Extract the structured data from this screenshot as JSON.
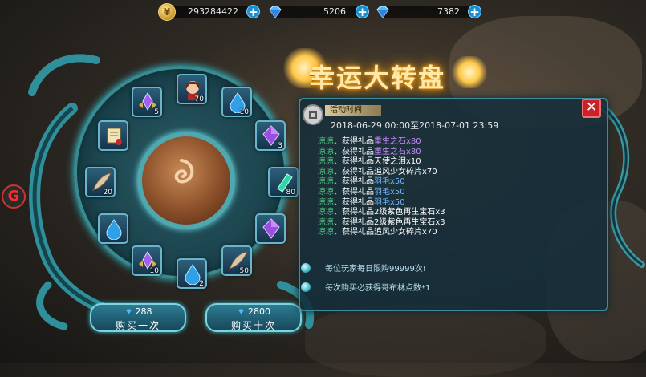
{
  "currencies": [
    {
      "icon": "gold-coin-icon",
      "value": "293284422"
    },
    {
      "icon": "diamond-icon",
      "value": "5206"
    },
    {
      "icon": "diamond-icon",
      "value": "7382"
    }
  ],
  "title": "幸运大转盘",
  "event": {
    "tag": "活动时间",
    "time": "2018-06-29  00:00至2018-07-01  23:59"
  },
  "wheel_items": [
    {
      "icon": "portrait-icon",
      "count": "70"
    },
    {
      "icon": "water-drop-icon",
      "count": "10"
    },
    {
      "icon": "purple-gem-icon",
      "count": "3"
    },
    {
      "icon": "green-crystal-icon",
      "count": "80"
    },
    {
      "icon": "purple-gem-icon",
      "count": ""
    },
    {
      "icon": "feather-icon",
      "count": "50"
    },
    {
      "icon": "water-drop-icon",
      "count": "2"
    },
    {
      "icon": "purple-crystal-crown-icon",
      "count": "10"
    },
    {
      "icon": "water-drop-icon",
      "count": ""
    },
    {
      "icon": "feather-icon",
      "count": "20"
    },
    {
      "icon": "scroll-icon",
      "count": ""
    },
    {
      "icon": "purple-crystal-crown-icon",
      "count": "5"
    }
  ],
  "log": [
    {
      "name": "凉凉",
      "sep": "、",
      "action": "获得礼品",
      "item": "重生之石x80",
      "color": "purple"
    },
    {
      "name": "凉凉",
      "sep": "、",
      "action": "获得礼品",
      "item": "重生之石x80",
      "color": "purple"
    },
    {
      "name": "凉凉",
      "sep": "、",
      "action": "获得礼品",
      "item": "天使之泪x10",
      "color": "white"
    },
    {
      "name": "凉凉",
      "sep": "、",
      "action": "获得礼品",
      "item": "追风少女碎片x70",
      "color": "white"
    },
    {
      "name": "凉凉",
      "sep": "、",
      "action": "获得礼品",
      "item": "羽毛x50",
      "color": "blue"
    },
    {
      "name": "凉凉",
      "sep": "、",
      "action": "获得礼品",
      "item": "羽毛x50",
      "color": "blue"
    },
    {
      "name": "凉凉",
      "sep": "、",
      "action": "获得礼品",
      "item": "羽毛x50",
      "color": "blue"
    },
    {
      "name": "凉凉",
      "sep": "、",
      "action": "获得礼品",
      "item": "2级紫色再生宝石x3",
      "color": "white"
    },
    {
      "name": "凉凉",
      "sep": "、",
      "action": "获得礼品",
      "item": "2级紫色再生宝石x3",
      "color": "white"
    },
    {
      "name": "凉凉",
      "sep": "、",
      "action": "获得礼品",
      "item": "追风少女碎片x70",
      "color": "white"
    }
  ],
  "notes": [
    "每位玩家每日限购99999次!",
    "每次购买必获得哥布林点数*1"
  ],
  "buy": [
    {
      "price": "288",
      "label": "购买一次"
    },
    {
      "price": "2800",
      "label": "购买十次"
    }
  ],
  "close_label": "✕"
}
